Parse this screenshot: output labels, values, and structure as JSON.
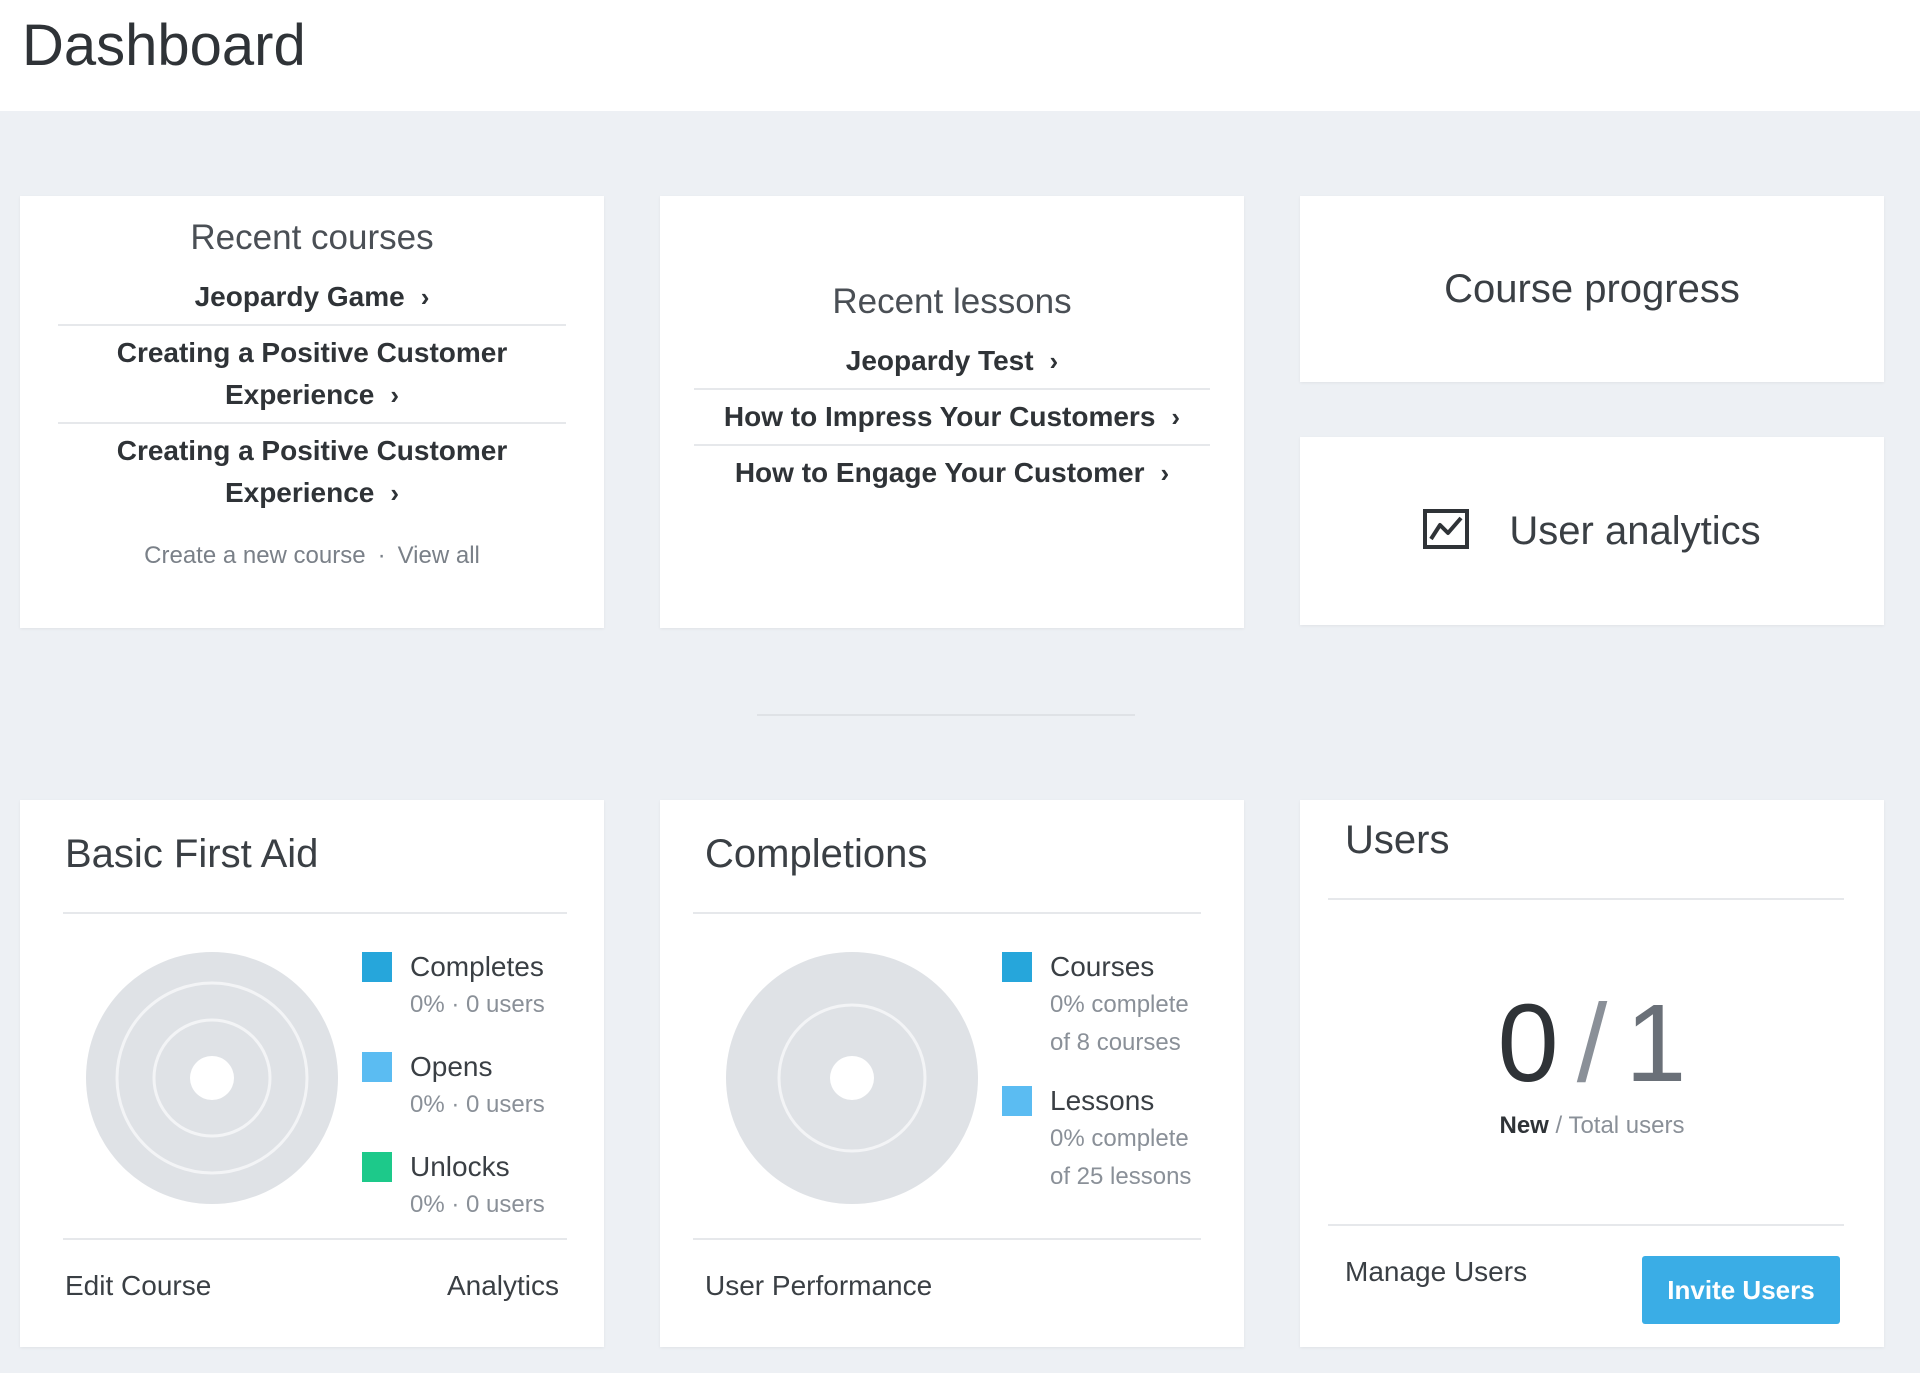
{
  "header": {
    "title": "Dashboard"
  },
  "recent_courses": {
    "title": "Recent courses",
    "items": [
      {
        "label": "Jeopardy Game"
      },
      {
        "label": "Creating a Positive Customer",
        "label2": "Experience"
      },
      {
        "label": "Creating a Positive Customer",
        "label2": "Experience"
      }
    ],
    "create_link": "Create a new course",
    "separator": "·",
    "view_all_link": "View all"
  },
  "recent_lessons": {
    "title": "Recent lessons",
    "items": [
      {
        "label": "Jeopardy Test"
      },
      {
        "label": "How to Impress Your Customers"
      },
      {
        "label": "How to Engage Your Customer"
      }
    ]
  },
  "course_progress": {
    "title": "Course progress"
  },
  "user_analytics": {
    "title": "User analytics",
    "icon": "line-chart-icon"
  },
  "first_aid": {
    "title": "Basic First Aid",
    "legend": [
      {
        "name": "Completes",
        "sub": "0% · 0 users",
        "color": "#26a6db"
      },
      {
        "name": "Opens",
        "sub": "0% · 0 users",
        "color": "#5bbcf2"
      },
      {
        "name": "Unlocks",
        "sub": "0% · 0 users",
        "color": "#1dc98a"
      }
    ],
    "edit_link": "Edit Course",
    "analytics_link": "Analytics"
  },
  "completions": {
    "title": "Completions",
    "legend": [
      {
        "name": "Courses",
        "sub": "0% complete",
        "sub2": "of 8 courses",
        "color": "#26a6db"
      },
      {
        "name": "Lessons",
        "sub": "0% complete",
        "sub2": "of 25 lessons",
        "color": "#5bbcf2"
      }
    ],
    "performance_link": "User Performance"
  },
  "users": {
    "title": "Users",
    "new_count": "0",
    "slash": "/",
    "total_count": "1",
    "caption_new": "New",
    "caption_sep": " / ",
    "caption_total": "Total users",
    "manage_link": "Manage Users",
    "invite_button": "Invite Users"
  }
}
